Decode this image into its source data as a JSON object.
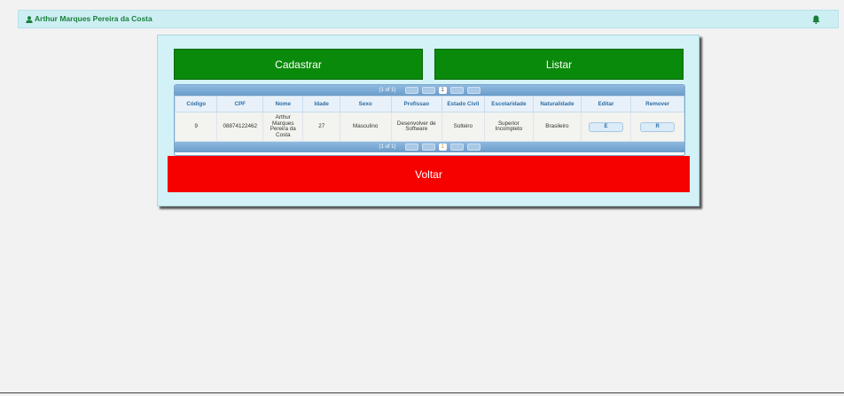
{
  "header": {
    "user_name": "Arthur Marques Pereira da Costa",
    "user_icon": "user-icon",
    "bell_icon": "bell-icon"
  },
  "actions": {
    "cadastrar_label": "Cadastrar",
    "listar_label": "Listar",
    "voltar_label": "Voltar"
  },
  "table": {
    "paginator": {
      "report": "(1 of 1)",
      "current_page": "1"
    },
    "columns": [
      "Código",
      "CPF",
      "Nome",
      "Idade",
      "Sexo",
      "Profissao",
      "Estado Civil",
      "Escolaridade",
      "Naturalidade",
      "Editar",
      "Remover"
    ],
    "rows": [
      {
        "codigo": "9",
        "cpf": "08874122462",
        "nome": "Arthur Marques Pereira da Costa",
        "idade": "27",
        "sexo": "Masculino",
        "profissao": "Desenvolver de Software",
        "estado_civil": "Solteiro",
        "escolaridade": "Superior Incompleto",
        "naturalidade": "Brasileiro",
        "editar_label": "E",
        "remover_label": "R"
      }
    ]
  },
  "colors": {
    "green": "#0a8a0a",
    "red": "#f70000",
    "panel": "#d2f2f7",
    "topbar": "#cdeff4"
  }
}
